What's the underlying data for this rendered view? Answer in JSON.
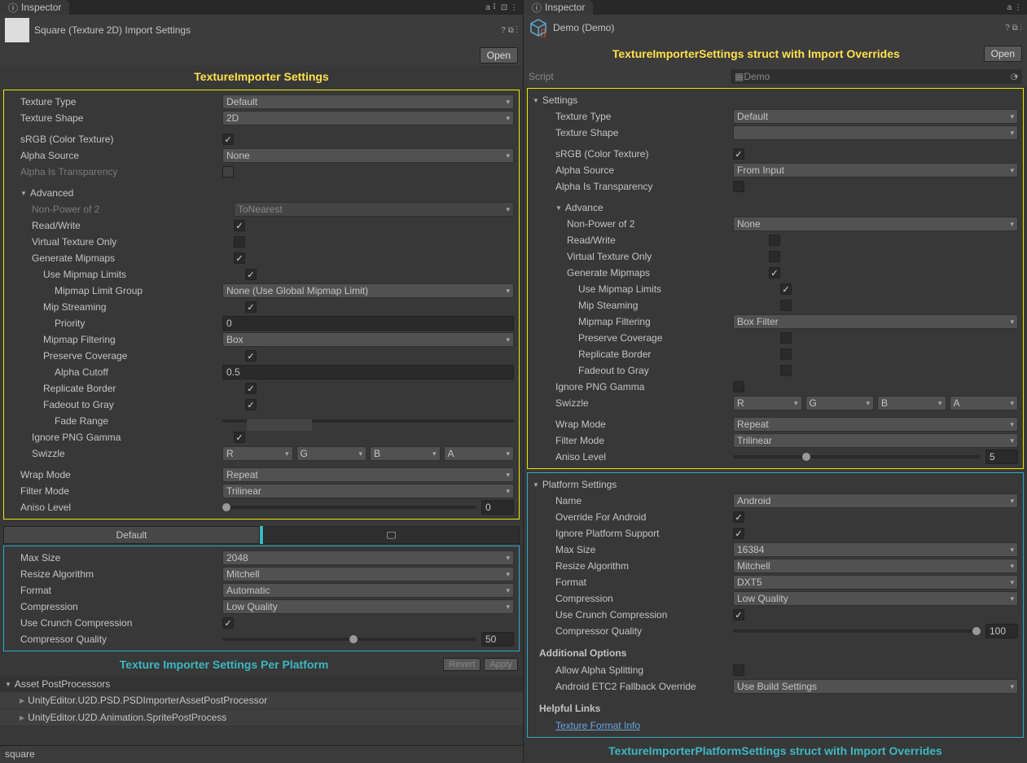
{
  "left": {
    "tab": "Inspector",
    "header_title": "Square (Texture 2D) Import Settings",
    "open_btn": "Open",
    "title": "TextureImporter Settings",
    "yellow": {
      "texture_type": {
        "label": "Texture Type",
        "value": "Default"
      },
      "texture_shape": {
        "label": "Texture Shape",
        "value": "2D"
      },
      "srgb": {
        "label": "sRGB (Color Texture)",
        "checked": true
      },
      "alpha_source": {
        "label": "Alpha Source",
        "value": "None"
      },
      "alpha_transparency": {
        "label": "Alpha Is Transparency",
        "checked": false
      },
      "advanced": "Advanced",
      "npot": {
        "label": "Non-Power of 2",
        "value": "ToNearest"
      },
      "readwrite": {
        "label": "Read/Write",
        "checked": true
      },
      "vto": {
        "label": "Virtual Texture Only",
        "checked": false
      },
      "genmip": {
        "label": "Generate Mipmaps",
        "checked": true
      },
      "usemiplimits": {
        "label": "Use Mipmap Limits",
        "checked": true
      },
      "miplimitgroup": {
        "label": "Mipmap Limit Group",
        "value": "None (Use Global Mipmap Limit)"
      },
      "mipstream": {
        "label": "Mip Streaming",
        "checked": true
      },
      "priority": {
        "label": "Priority",
        "value": "0"
      },
      "mipfilter": {
        "label": "Mipmap Filtering",
        "value": "Box"
      },
      "preservecov": {
        "label": "Preserve Coverage",
        "checked": true
      },
      "alphacutoff": {
        "label": "Alpha Cutoff",
        "value": "0.5"
      },
      "repborder": {
        "label": "Replicate Border",
        "checked": true
      },
      "fadeout": {
        "label": "Fadeout to Gray",
        "checked": true
      },
      "faderange": {
        "label": "Fade Range"
      },
      "ignorepng": {
        "label": "Ignore PNG Gamma",
        "checked": true
      },
      "swizzle": {
        "label": "Swizzle",
        "r": "R",
        "g": "G",
        "b": "B",
        "a": "A"
      },
      "wrap": {
        "label": "Wrap Mode",
        "value": "Repeat"
      },
      "filter": {
        "label": "Filter Mode",
        "value": "Trilinear"
      },
      "aniso": {
        "label": "Aniso Level",
        "value": "0"
      }
    },
    "platform": {
      "default_tab": "Default",
      "maxsize": {
        "label": "Max Size",
        "value": "2048"
      },
      "resize": {
        "label": "Resize Algorithm",
        "value": "Mitchell"
      },
      "format": {
        "label": "Format",
        "value": "Automatic"
      },
      "compression": {
        "label": "Compression",
        "value": "Low Quality"
      },
      "crunch": {
        "label": "Use Crunch Compression",
        "checked": true
      },
      "quality": {
        "label": "Compressor Quality",
        "value": "50"
      }
    },
    "platform_title": "Texture Importer Settings Per Platform",
    "revert": "Revert",
    "apply": "Apply",
    "postprocessors": "Asset PostProcessors",
    "pp1": "UnityEditor.U2D.PSD.PSDImporterAssetPostProcessor",
    "pp2": "UnityEditor.U2D.Animation.SpritePostProcess",
    "footer": "square"
  },
  "right": {
    "tab": "Inspector",
    "header_title": "Demo (Demo)",
    "open_btn": "Open",
    "title": "TextureImporterSettings struct with Import Overrides",
    "script_label": "Script",
    "script_value": "Demo",
    "yellow": {
      "settings": "Settings",
      "texture_type": {
        "label": "Texture Type",
        "value": "Default"
      },
      "texture_shape": {
        "label": "Texture Shape",
        "value": ""
      },
      "srgb": {
        "label": "sRGB (Color Texture)",
        "checked": true
      },
      "alpha_source": {
        "label": "Alpha Source",
        "value": "From Input"
      },
      "alpha_transparency": {
        "label": "Alpha Is Transparency",
        "checked": false
      },
      "advance": "Advance",
      "npot": {
        "label": "Non-Power of 2",
        "value": "None"
      },
      "readwrite": {
        "label": "Read/Write",
        "checked": false
      },
      "vto": {
        "label": "Virtual Texture Only",
        "checked": false
      },
      "genmip": {
        "label": "Generate Mipmaps",
        "checked": true
      },
      "usemiplimits": {
        "label": "Use Mipmap Limits",
        "checked": true
      },
      "mipsteam": {
        "label": "Mip Steaming",
        "checked": false
      },
      "mipfilter": {
        "label": "Mipmap Filtering",
        "value": "Box Filter"
      },
      "preservecov": {
        "label": "Preserve Coverage",
        "checked": false
      },
      "repborder": {
        "label": "Replicate Border",
        "checked": false
      },
      "fadeout": {
        "label": "Fadeout to Gray",
        "checked": false
      },
      "ignorepng": {
        "label": "Ignore PNG Gamma",
        "checked": false
      },
      "swizzle": {
        "label": "Swizzle",
        "r": "R",
        "g": "G",
        "b": "B",
        "a": "A"
      },
      "wrap": {
        "label": "Wrap Mode",
        "value": "Repeat"
      },
      "filter": {
        "label": "Filter Mode",
        "value": "Trilinear"
      },
      "aniso": {
        "label": "Aniso Level",
        "value": "5"
      }
    },
    "platform": {
      "title": "Platform Settings",
      "name": {
        "label": "Name",
        "value": "Android"
      },
      "override": {
        "label": "Override For Android",
        "checked": true
      },
      "ignore": {
        "label": "Ignore Platform Support",
        "checked": true
      },
      "maxsize": {
        "label": "Max Size",
        "value": "16384"
      },
      "resize": {
        "label": "Resize Algorithm",
        "value": "Mitchell"
      },
      "format": {
        "label": "Format",
        "value": "DXT5"
      },
      "compression": {
        "label": "Compression",
        "value": "Low Quality"
      },
      "crunch": {
        "label": "Use Crunch Compression",
        "checked": true
      },
      "quality": {
        "label": "Compressor Quality",
        "value": "100"
      },
      "addl": "Additional Options",
      "alphasplit": {
        "label": "Allow Alpha Splitting",
        "checked": false
      },
      "etc2": {
        "label": "Android ETC2 Fallback Override",
        "value": "Use Build Settings"
      },
      "links": "Helpful Links",
      "formatinfo": "Texture Format Info"
    },
    "platform_title": "TextureImporterPlatformSettings struct with Import Overrides"
  }
}
